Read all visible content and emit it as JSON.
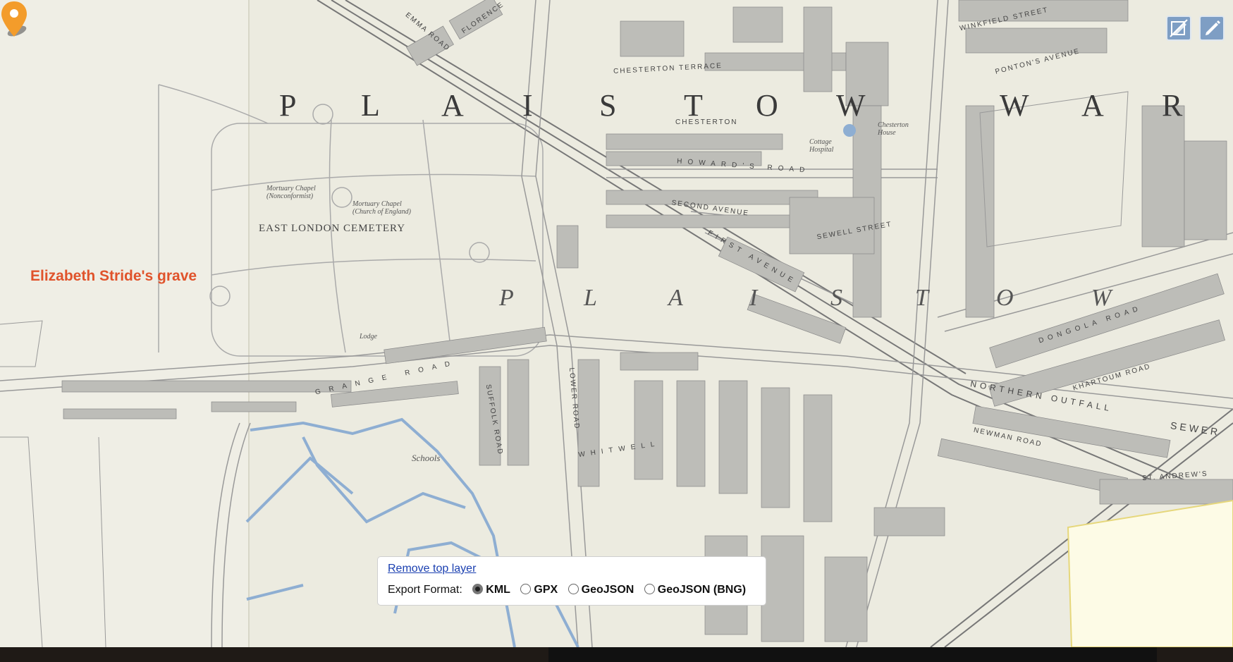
{
  "map": {
    "district_title_top": [
      "P",
      "L",
      "A",
      "I",
      "S",
      "T",
      "O",
      "W"
    ],
    "district_title_right": [
      "W",
      "A",
      "R"
    ],
    "district_title_italic": [
      "P",
      "L",
      "A",
      "I",
      "S",
      "T",
      "O",
      "W"
    ],
    "cemetery": "EAST LONDON CEMETERY",
    "chapel_nonconformist": "Mortuary Chapel (Nonconformist)",
    "chapel_england": "Mortuary Chapel (Church of England)",
    "lodge": "Lodge",
    "schools": "Schools",
    "chesterton_house": "Chesterton House",
    "cottage_hospital": "Cottage Hospital",
    "streets": {
      "chesterton_terrace": "CHESTERTON TERRACE",
      "chesterton": "CHESTERTON",
      "howards_road": "HOWARD'S ROAD",
      "second_avenue": "SECOND AVENUE",
      "first_avenue": "FIRST AVENUE",
      "sewell_street": "SEWELL STREET",
      "northern_outfall": "NORTHERN OUTFALL",
      "sewer": "SEWER",
      "newman_road": "NEWMAN ROAD",
      "khartoum_road": "KHARTOUM ROAD",
      "dongola_road": "DONGOLA ROAD",
      "winkfield_street": "WINKFIELD STREET",
      "ponton_avenue": "PONTON'S AVENUE",
      "grange_road": "GRANGE ROAD",
      "whitwell": "WHITWELL",
      "suffolk_road": "SUFFOLK ROAD",
      "lower_road": "LOWER ROAD",
      "emma_road": "EMMA ROAD",
      "florence": "FLORENCE",
      "st_andrews": "ST. ANDREW'S",
      "newman": "NEWMAN"
    }
  },
  "marker": {
    "label": "Elizabeth Stride's grave",
    "icon": "map-pin-icon",
    "color": "#f39c2b"
  },
  "controls": {
    "edit_disabled_icon": "edit-off-icon",
    "edit_icon": "pencil-icon"
  },
  "layer_panel": {
    "remove_link": "Remove top layer",
    "export_label": "Export Format:",
    "options": [
      "KML",
      "GPX",
      "GeoJSON",
      "GeoJSON (BNG)"
    ],
    "selected": "KML"
  }
}
